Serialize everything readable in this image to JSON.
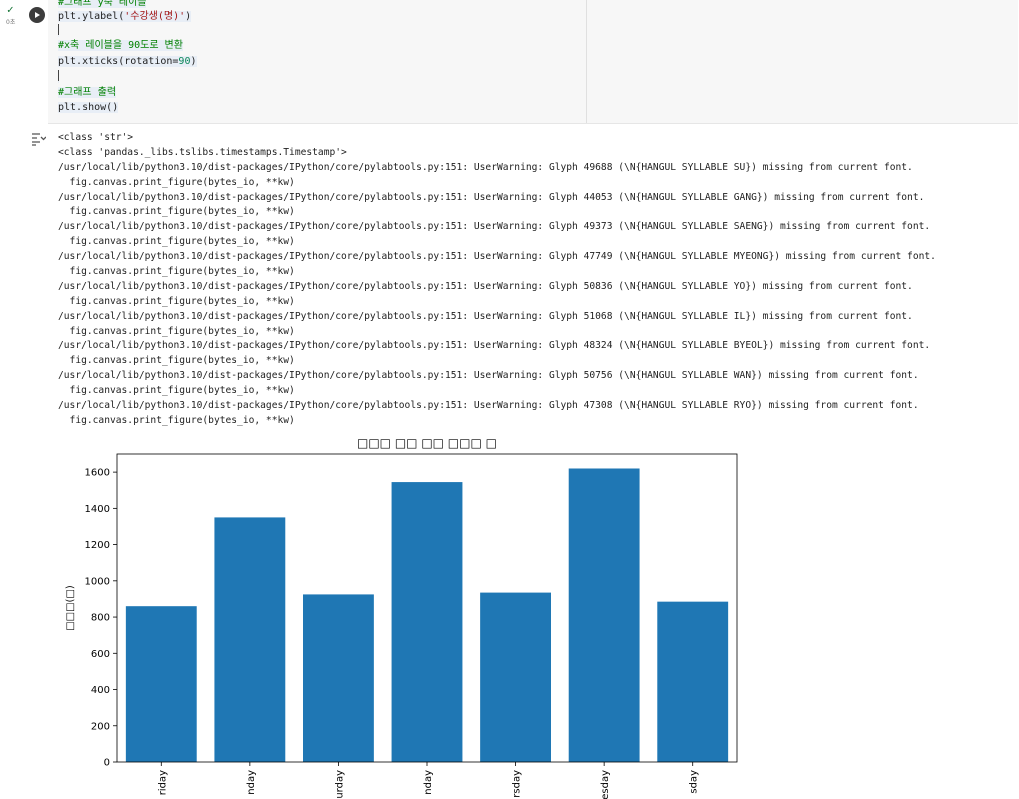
{
  "cell": {
    "status_time": "0초",
    "code_lines": [
      {
        "kind": "comment",
        "text": "#그래프 y축 레이블"
      },
      {
        "kind": "call",
        "fn": "plt.ylabel(",
        "arg": "'수강생(명)'",
        "end": ")"
      },
      {
        "kind": "blank",
        "text": ""
      },
      {
        "kind": "comment",
        "text": "#x축 레이블을 90도로 변환"
      },
      {
        "kind": "call",
        "fn": "plt.xticks(rotation=",
        "arg": "90",
        "end": ")"
      },
      {
        "kind": "blank",
        "text": ""
      },
      {
        "kind": "comment",
        "text": "#그래프 출력"
      },
      {
        "kind": "call",
        "fn": "plt.show(",
        "arg": "",
        "end": ")"
      }
    ]
  },
  "output": {
    "lines": [
      "<class 'str'>",
      "<class 'pandas._libs.tslibs.timestamps.Timestamp'>",
      "/usr/local/lib/python3.10/dist-packages/IPython/core/pylabtools.py:151: UserWarning: Glyph 49688 (\\N{HANGUL SYLLABLE SU}) missing from current font.",
      "  fig.canvas.print_figure(bytes_io, **kw)",
      "/usr/local/lib/python3.10/dist-packages/IPython/core/pylabtools.py:151: UserWarning: Glyph 44053 (\\N{HANGUL SYLLABLE GANG}) missing from current font.",
      "  fig.canvas.print_figure(bytes_io, **kw)",
      "/usr/local/lib/python3.10/dist-packages/IPython/core/pylabtools.py:151: UserWarning: Glyph 49373 (\\N{HANGUL SYLLABLE SAENG}) missing from current font.",
      "  fig.canvas.print_figure(bytes_io, **kw)",
      "/usr/local/lib/python3.10/dist-packages/IPython/core/pylabtools.py:151: UserWarning: Glyph 47749 (\\N{HANGUL SYLLABLE MYEONG}) missing from current font.",
      "  fig.canvas.print_figure(bytes_io, **kw)",
      "/usr/local/lib/python3.10/dist-packages/IPython/core/pylabtools.py:151: UserWarning: Glyph 50836 (\\N{HANGUL SYLLABLE YO}) missing from current font.",
      "  fig.canvas.print_figure(bytes_io, **kw)",
      "/usr/local/lib/python3.10/dist-packages/IPython/core/pylabtools.py:151: UserWarning: Glyph 51068 (\\N{HANGUL SYLLABLE IL}) missing from current font.",
      "  fig.canvas.print_figure(bytes_io, **kw)",
      "/usr/local/lib/python3.10/dist-packages/IPython/core/pylabtools.py:151: UserWarning: Glyph 48324 (\\N{HANGUL SYLLABLE BYEOL}) missing from current font.",
      "  fig.canvas.print_figure(bytes_io, **kw)",
      "/usr/local/lib/python3.10/dist-packages/IPython/core/pylabtools.py:151: UserWarning: Glyph 50756 (\\N{HANGUL SYLLABLE WAN}) missing from current font.",
      "  fig.canvas.print_figure(bytes_io, **kw)",
      "/usr/local/lib/python3.10/dist-packages/IPython/core/pylabtools.py:151: UserWarning: Glyph 47308 (\\N{HANGUL SYLLABLE RYO}) missing from current font.",
      "  fig.canvas.print_figure(bytes_io, **kw)"
    ]
  },
  "chart_data": {
    "type": "bar",
    "title": "□□□ □□ □□ □□□ □",
    "ylabel": "□□□(□)",
    "categories": [
      "riday",
      "nday",
      "urday",
      "nday",
      "rsday",
      "esday",
      "sday"
    ],
    "values": [
      860,
      1350,
      925,
      1545,
      935,
      1620,
      885
    ],
    "ylim": [
      0,
      1700
    ],
    "yticks": [
      0,
      200,
      400,
      600,
      800,
      1000,
      1200,
      1400,
      1600
    ],
    "bar_color": "#1f77b4",
    "grid": false
  }
}
